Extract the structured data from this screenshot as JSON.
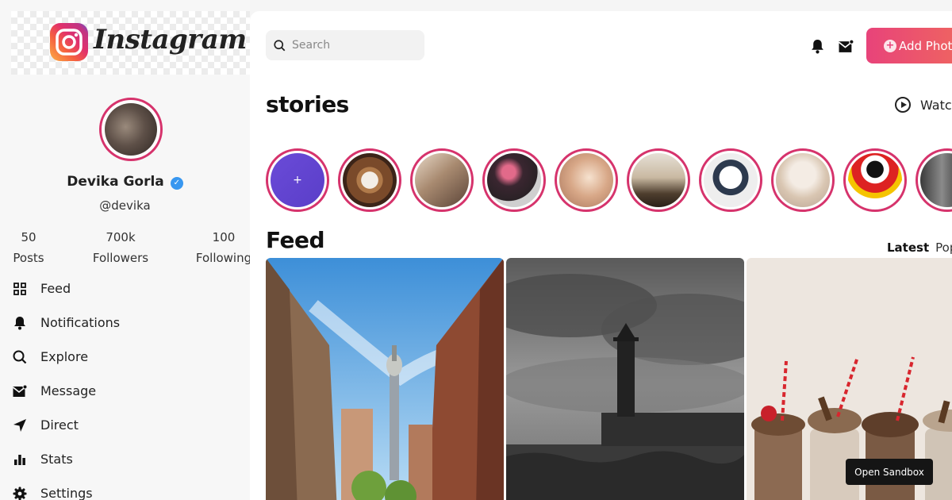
{
  "brand": {
    "name": "Instagram"
  },
  "profile": {
    "name": "Devika Gorla",
    "handle": "@devika",
    "verified": true,
    "stats": [
      {
        "value": "50",
        "label": "Posts"
      },
      {
        "value": "700k",
        "label": "Followers"
      },
      {
        "value": "100",
        "label": "Following"
      }
    ]
  },
  "nav": {
    "items": [
      {
        "label": "Feed",
        "icon": "grid-icon"
      },
      {
        "label": "Notifications",
        "icon": "bell-icon"
      },
      {
        "label": "Explore",
        "icon": "search-icon"
      },
      {
        "label": "Message",
        "icon": "mail-icon"
      },
      {
        "label": "Direct",
        "icon": "send-icon"
      },
      {
        "label": "Stats",
        "icon": "bar-chart-icon"
      },
      {
        "label": "Settings",
        "icon": "gear-icon"
      }
    ]
  },
  "header": {
    "search_placeholder": "Search",
    "add_button_label": "Add Photo"
  },
  "stories": {
    "title": "stories",
    "watch_label": "Watch all",
    "add_story_symbol": "+",
    "count": 10
  },
  "feed": {
    "title": "Feed",
    "tabs": [
      "Latest",
      "Popular"
    ],
    "active_tab": "Latest",
    "posts": [
      {
        "subject": "city street with tower"
      },
      {
        "subject": "lighthouse black and white"
      },
      {
        "subject": "milkshakes"
      }
    ]
  },
  "sandbox": {
    "label": "Open Sandbox"
  },
  "colors": {
    "accent": "#d6336c",
    "button_gradient_start": "#e8437a",
    "button_gradient_end": "#f06a5c",
    "verified": "#3897f0"
  }
}
